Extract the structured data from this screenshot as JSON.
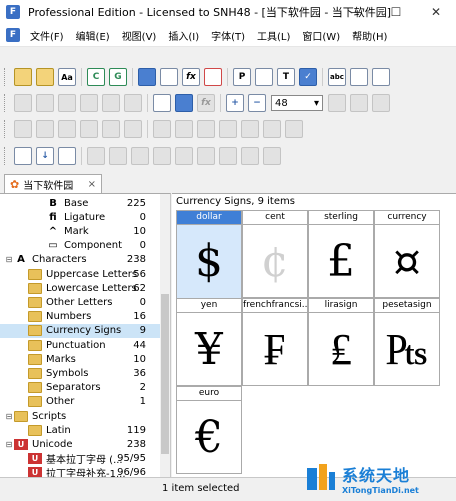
{
  "window": {
    "title": "Professional Edition - Licensed to SNH48 - [当下软件园 - 当下软件园]",
    "minimize": "—",
    "maximize": "☐",
    "close": "✕"
  },
  "menu": [
    "文件(F)",
    "编辑(E)",
    "视图(V)",
    "插入(I)",
    "字体(T)",
    "工具(L)",
    "窗口(W)",
    "帮助(H)"
  ],
  "toolbar": {
    "zoom_value": "48"
  },
  "document_tab": {
    "label": "当下软件园",
    "close": "×"
  },
  "tree": [
    {
      "label": "Base",
      "count": "225",
      "icon": "glyph-icon",
      "glyph": "B",
      "indent": 2
    },
    {
      "label": "Ligature",
      "count": "0",
      "icon": "glyph-icon",
      "glyph": "fi",
      "indent": 2
    },
    {
      "label": "Mark",
      "count": "10",
      "icon": "glyph-icon",
      "glyph": "^",
      "indent": 2
    },
    {
      "label": "Component",
      "count": "0",
      "icon": "glyph-icon",
      "glyph": "▭",
      "indent": 2
    },
    {
      "label": "Characters",
      "count": "238",
      "icon": "glyph-icon",
      "glyph": "A",
      "indent": 0,
      "expander": "⊟"
    },
    {
      "label": "Uppercase Letters",
      "count": "56",
      "icon": "folder-icon",
      "indent": 1
    },
    {
      "label": "Lowercase Letters",
      "count": "62",
      "icon": "folder-icon",
      "indent": 1
    },
    {
      "label": "Other Letters",
      "count": "0",
      "icon": "folder-icon",
      "indent": 1
    },
    {
      "label": "Numbers",
      "count": "16",
      "icon": "folder-icon",
      "indent": 1
    },
    {
      "label": "Currency Signs",
      "count": "9",
      "icon": "folder-icon",
      "indent": 1,
      "selected": true
    },
    {
      "label": "Punctuation",
      "count": "44",
      "icon": "folder-icon",
      "indent": 1
    },
    {
      "label": "Marks",
      "count": "10",
      "icon": "folder-icon",
      "indent": 1
    },
    {
      "label": "Symbols",
      "count": "36",
      "icon": "folder-icon",
      "indent": 1
    },
    {
      "label": "Separators",
      "count": "2",
      "icon": "folder-icon",
      "indent": 1
    },
    {
      "label": "Other",
      "count": "1",
      "icon": "folder-icon",
      "indent": 1
    },
    {
      "label": "Scripts",
      "count": "",
      "icon": "folder-icon",
      "indent": 0,
      "expander": "⊟"
    },
    {
      "label": "Latin",
      "count": "119",
      "icon": "folder-icon",
      "indent": 1
    },
    {
      "label": "Unicode",
      "count": "238",
      "icon": "unicode-icon",
      "indent": 0,
      "expander": "⊟"
    },
    {
      "label": "基本拉丁字母 (...",
      "count": "95/95",
      "icon": "unicode-icon",
      "indent": 1
    },
    {
      "label": "拉丁字母补充-1...",
      "count": "96/96",
      "icon": "unicode-icon",
      "indent": 1
    }
  ],
  "grid": {
    "title": "Currency Signs, 9 items",
    "cells": [
      {
        "name": "dollar",
        "glyph": "$",
        "selected": true
      },
      {
        "name": "cent",
        "glyph": "¢",
        "gray": true
      },
      {
        "name": "sterling",
        "glyph": "£"
      },
      {
        "name": "currency",
        "glyph": "¤"
      },
      {
        "name": "yen",
        "glyph": "¥"
      },
      {
        "name": "frenchfrancsi...",
        "glyph": "₣"
      },
      {
        "name": "lirasign",
        "glyph": "₤"
      },
      {
        "name": "pesetasign",
        "glyph": "₧"
      },
      {
        "name": "euro",
        "glyph": "€"
      }
    ]
  },
  "status": {
    "text": "1 item selected"
  },
  "watermark": {
    "main": "系统天地",
    "sub": "XiTongTianDi.net"
  },
  "colors": {
    "selection": "#cce4f7",
    "selected_cell_header": "#3f7fd6",
    "folder": "#e8c15a",
    "watermark": "#1a7fd6"
  }
}
